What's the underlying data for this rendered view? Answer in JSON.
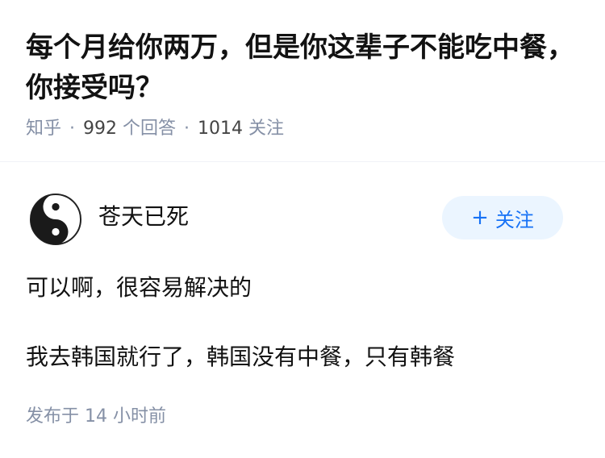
{
  "question": {
    "title": "每个月给你两万，但是你这辈子不能吃中餐，你接受吗？",
    "source": "知乎",
    "answers_count": "992",
    "answers_label": "个回答",
    "follow_count": "1014",
    "follow_label": "关注"
  },
  "answer": {
    "author": {
      "name": "苍天已死",
      "avatar_icon": "yin-yang-icon"
    },
    "follow_button": {
      "icon": "+",
      "label": "关注"
    },
    "paragraphs": [
      "可以啊，很容易解决的",
      "我去韩国就行了，韩国没有中餐，只有韩餐"
    ],
    "published": "发布于 14 小时前"
  },
  "colors": {
    "meta_gray": "#8590a6",
    "brand_blue": "#1772f6",
    "follow_bg": "#ebf5ff"
  }
}
